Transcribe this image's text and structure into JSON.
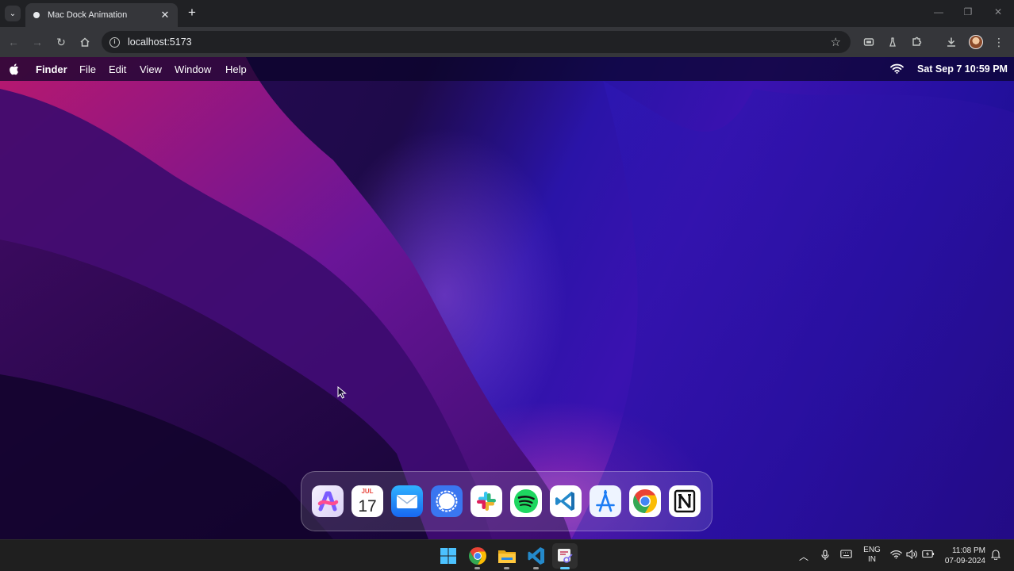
{
  "browser": {
    "tab": {
      "title": "Mac Dock Animation"
    },
    "url": "localhost:5173"
  },
  "menubar": {
    "items": [
      "Finder",
      "File",
      "Edit",
      "View",
      "Window",
      "Help"
    ],
    "datetime": "Sat Sep 7 10:59 PM"
  },
  "dock": {
    "apps": [
      {
        "name": "Arc",
        "icon": "arc-icon"
      },
      {
        "name": "Calendar",
        "icon": "calendar-icon",
        "month": "JUL",
        "day": "17"
      },
      {
        "name": "Mail",
        "icon": "mail-icon"
      },
      {
        "name": "Signal",
        "icon": "signal-icon"
      },
      {
        "name": "Slack",
        "icon": "slack-icon"
      },
      {
        "name": "Spotify",
        "icon": "spotify-icon"
      },
      {
        "name": "VS Code",
        "icon": "vscode-icon"
      },
      {
        "name": "App Store",
        "icon": "appstore-icon"
      },
      {
        "name": "Chrome",
        "icon": "chrome-icon"
      },
      {
        "name": "Notion",
        "icon": "notion-icon"
      }
    ]
  },
  "taskbar": {
    "apps": [
      "start-icon",
      "chrome-icon",
      "file-explorer-icon",
      "vscode-icon",
      "snipping-tool-icon"
    ],
    "language": {
      "line1": "ENG",
      "line2": "IN"
    },
    "time": "11:08 PM",
    "date": "07-09-2024"
  },
  "colors": {
    "menubar_bg": "#0a0428",
    "taskbar_bg": "#1f1f1f",
    "chrome_bg": "#202124"
  }
}
